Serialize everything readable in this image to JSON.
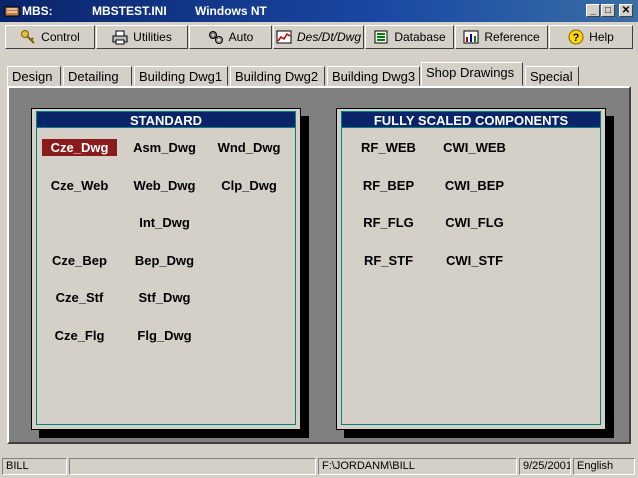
{
  "window": {
    "app": "MBS:",
    "file": "MBSTEST.INI",
    "os": "Windows NT",
    "minimize": "_",
    "maximize": "□",
    "close": "✕"
  },
  "toolbar": [
    {
      "label": "Control",
      "icon": "key-icon"
    },
    {
      "label": "Utilities",
      "icon": "printer-icon"
    },
    {
      "label": "Auto",
      "icon": "gears-icon"
    },
    {
      "label": "Des/Dt/Dwg",
      "icon": "chart-icon"
    },
    {
      "label": "Database",
      "icon": "database-icon"
    },
    {
      "label": "Reference",
      "icon": "reference-chart-icon"
    },
    {
      "label": "Help",
      "icon": "help-icon"
    }
  ],
  "tabs": [
    "Design",
    "Detailing",
    "Building Dwg1",
    "Building Dwg2",
    "Building Dwg3",
    "Shop Drawings",
    "Special"
  ],
  "active_tab": "Shop Drawings",
  "standard": {
    "title": "STANDARD",
    "items": [
      "Cze_Dwg",
      "Asm_Dwg",
      "Wnd_Dwg",
      "Cze_Web",
      "Web_Dwg",
      "Clp_Dwg",
      "Int_Dwg",
      "Cze_Bep",
      "Bep_Dwg",
      "Cze_Stf",
      "Stf_Dwg",
      "Cze_Flg",
      "Flg_Dwg"
    ],
    "selected": "Cze_Dwg"
  },
  "scaled": {
    "title": "FULLY SCALED COMPONENTS",
    "items": [
      "RF_WEB",
      "CWI_WEB",
      "RF_BEP",
      "CWI_BEP",
      "RF_FLG",
      "CWI_FLG",
      "RF_STF",
      "CWI_STF"
    ]
  },
  "status": {
    "user": "BILL",
    "path": "F:\\JORDANM\\BILL",
    "date": "9/25/2001",
    "language": "English"
  },
  "colors": {
    "titlebar": "#0a246a",
    "panel_header": "#0a246a",
    "selected_item": "#8b1a1a",
    "panel_border": "#008080"
  }
}
